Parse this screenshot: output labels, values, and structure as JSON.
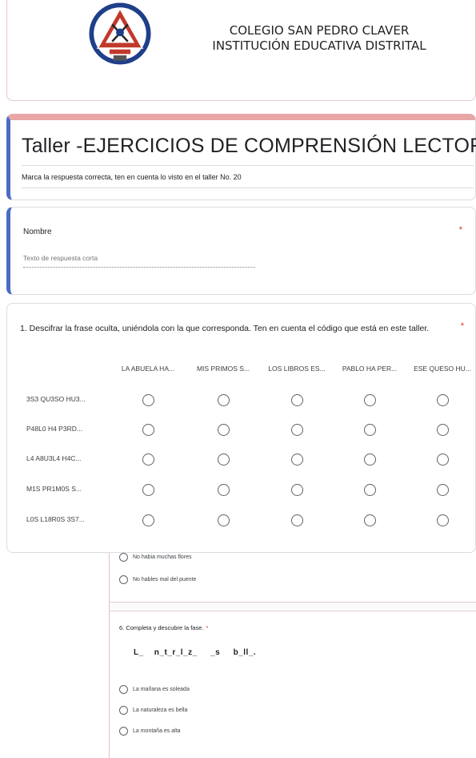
{
  "header": {
    "school_line1": "COLEGIO SAN PEDRO CLAVER",
    "school_line2": "INSTITUCIÓN EDUCATIVA DISTRITAL"
  },
  "form": {
    "title": "Taller -EJERCICIOS DE COMPRENSIÓN LECTORA",
    "description": "Marca la respuesta correcta, ten en cuenta lo visto en el taller No. 20"
  },
  "name_question": {
    "label": "Nombre",
    "required_mark": "*",
    "placeholder": "Texto de respuesta corta"
  },
  "grid_question": {
    "text": "1. Descifrar la frase oculta, uniéndola con la que corresponda.     Ten en cuenta el código que está en este taller.",
    "required_mark": "*",
    "columns": [
      "LA ABUELA HA...",
      "MIS PRIMOS S...",
      "LOS LIBROS ES...",
      "PABLO HA PER...",
      "ESE QUESO HU..."
    ],
    "rows": [
      "3S3 QU3SO HU3...",
      "P48L0 H4 P3RD...",
      "L4 A8U3L4 H4C...",
      "M1S PR1M0S S...",
      "L0S L18R0S 3S7..."
    ]
  },
  "prev_question": {
    "options": [
      "No habia muchas flores",
      "No hables mal del puente"
    ]
  },
  "q6": {
    "text": "6. Completa y descubre la fase.",
    "required_mark": "*",
    "puzzle": "L_    n_t_r_l_z_     _s     b_ll_.",
    "options": [
      "La mañana es soleada",
      "La naturaleza es bella",
      "La montaña es alta"
    ]
  },
  "colors": {
    "accent_blue": "#4a6cc5",
    "header_pink": "#e8a6a6",
    "required_red": "#d93025"
  }
}
